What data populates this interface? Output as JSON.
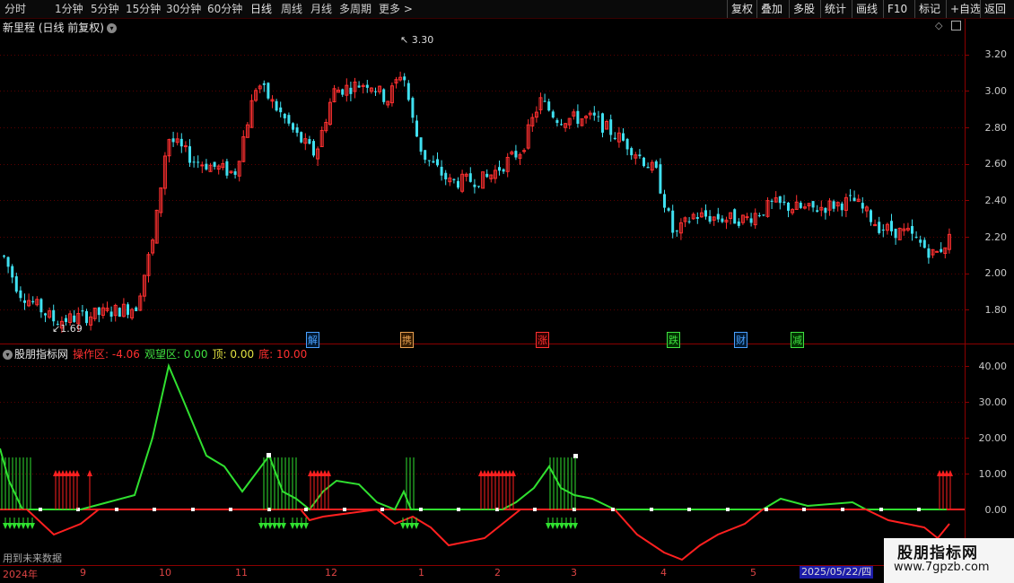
{
  "toolbar": {
    "periods": [
      "分时",
      "1分钟",
      "5分钟",
      "15分钟",
      "30分钟",
      "60分钟",
      "日线",
      "周线",
      "月线",
      "多周期",
      "更多 >"
    ],
    "right_buttons": [
      "复权",
      "叠加",
      "多股",
      "统计",
      "画线",
      "F10",
      "标记",
      "+自选",
      "返回"
    ]
  },
  "main_panel": {
    "title": "新里程 (日线 前复权)",
    "y_ticks": [
      "3.20",
      "3.00",
      "2.80",
      "2.60",
      "2.40",
      "2.20",
      "2.00",
      "1.80"
    ],
    "high_label": "3.30",
    "low_label": "1.69",
    "events": [
      {
        "text": "解",
        "color": "#4aa0ff"
      },
      {
        "text": "携",
        "color": "#e8a050"
      },
      {
        "text": "涨",
        "color": "#ff3030"
      },
      {
        "text": "跌",
        "color": "#40e040"
      },
      {
        "text": "财",
        "color": "#4aa0ff"
      },
      {
        "text": "减",
        "color": "#40e040"
      }
    ]
  },
  "indicator_panel": {
    "name": "股朋指标网",
    "items": [
      {
        "label": "操作区: -4.06",
        "color": "#ff3030"
      },
      {
        "label": "观望区: 0.00",
        "color": "#40e040"
      },
      {
        "label": "顶: 0.00",
        "color": "#e0e040"
      },
      {
        "label": "底: 10.00",
        "color": "#ff3030"
      }
    ],
    "y_ticks": [
      "40.00",
      "30.00",
      "20.00",
      "10.00",
      "0.00"
    ],
    "footer_note": "用到未来数据"
  },
  "date_axis": {
    "labels": [
      "2024年",
      "9",
      "10",
      "11",
      "12",
      "1",
      "2",
      "3",
      "4",
      "5"
    ],
    "cursor_date": "2025/05/22/四"
  },
  "watermark": {
    "title": "股朋指标网",
    "url": "www.7gpzb.com"
  },
  "colors": {
    "up": "#ff3030",
    "down": "#40e0f0",
    "panel_border": "#8b0000",
    "ind_green": "#30e030",
    "ind_red": "#ff2020"
  }
}
